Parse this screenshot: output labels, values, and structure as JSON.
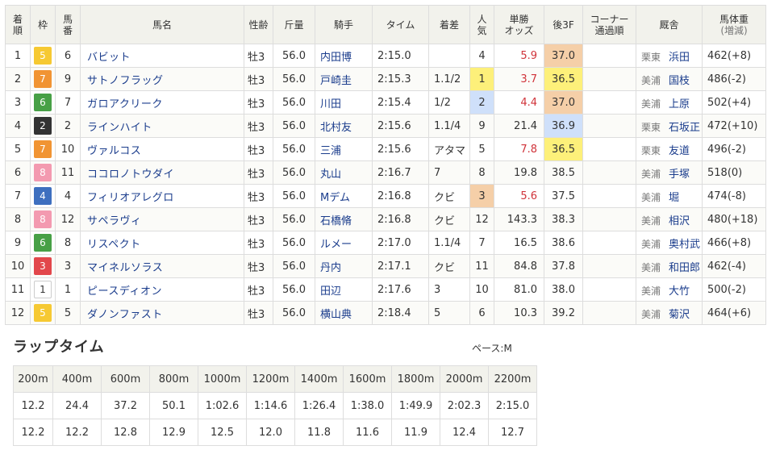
{
  "headers": {
    "rank": "着順",
    "waku": "枠",
    "num": "馬番",
    "name": "馬名",
    "sexage": "性齢",
    "weight": "斤量",
    "jockey": "騎手",
    "time": "タイム",
    "margin": "着差",
    "pop": "人気",
    "odds": "単勝オッズ",
    "f3": "後3F",
    "corner": "コーナー通過順",
    "trainer": "厩舎",
    "body": "馬体重(増減)"
  },
  "rows": [
    {
      "rank": "1",
      "waku": "5",
      "num": "6",
      "name": "バビット",
      "sexage": "牡3",
      "weight": "56.0",
      "jockey": "内田博",
      "time": "2:15.0",
      "margin": "",
      "pop": "4",
      "odds": "5.9",
      "f3": "37.0",
      "corner": "",
      "region": "栗東",
      "trainer": "浜田",
      "body": "462(+8)"
    },
    {
      "rank": "2",
      "waku": "7",
      "num": "9",
      "name": "サトノフラッグ",
      "sexage": "牡3",
      "weight": "56.0",
      "jockey": "戸崎圭",
      "time": "2:15.3",
      "margin": "1.1/2",
      "pop": "1",
      "odds": "3.7",
      "f3": "36.5",
      "corner": "",
      "region": "美浦",
      "trainer": "国枝",
      "body": "486(-2)"
    },
    {
      "rank": "3",
      "waku": "6",
      "num": "7",
      "name": "ガロアクリーク",
      "sexage": "牡3",
      "weight": "56.0",
      "jockey": "川田",
      "time": "2:15.4",
      "margin": "1/2",
      "pop": "2",
      "odds": "4.4",
      "f3": "37.0",
      "corner": "",
      "region": "美浦",
      "trainer": "上原",
      "body": "502(+4)"
    },
    {
      "rank": "4",
      "waku": "2",
      "num": "2",
      "name": "ラインハイト",
      "sexage": "牡3",
      "weight": "56.0",
      "jockey": "北村友",
      "time": "2:15.6",
      "margin": "1.1/4",
      "pop": "9",
      "odds": "21.4",
      "f3": "36.9",
      "corner": "",
      "region": "栗東",
      "trainer": "石坂正",
      "body": "472(+10)"
    },
    {
      "rank": "5",
      "waku": "7",
      "num": "10",
      "name": "ヴァルコス",
      "sexage": "牡3",
      "weight": "56.0",
      "jockey": "三浦",
      "time": "2:15.6",
      "margin": "アタマ",
      "pop": "5",
      "odds": "7.8",
      "f3": "36.5",
      "corner": "",
      "region": "栗東",
      "trainer": "友道",
      "body": "496(-2)"
    },
    {
      "rank": "6",
      "waku": "8",
      "num": "11",
      "name": "ココロノトウダイ",
      "sexage": "牡3",
      "weight": "56.0",
      "jockey": "丸山",
      "time": "2:16.7",
      "margin": "7",
      "pop": "8",
      "odds": "19.8",
      "f3": "38.5",
      "corner": "",
      "region": "美浦",
      "trainer": "手塚",
      "body": "518(0)"
    },
    {
      "rank": "7",
      "waku": "4",
      "num": "4",
      "name": "フィリオアレグロ",
      "sexage": "牡3",
      "weight": "56.0",
      "jockey": "Mデム",
      "time": "2:16.8",
      "margin": "クビ",
      "pop": "3",
      "odds": "5.6",
      "f3": "37.5",
      "corner": "",
      "region": "美浦",
      "trainer": "堀",
      "body": "474(-8)"
    },
    {
      "rank": "8",
      "waku": "8",
      "num": "12",
      "name": "サペラヴィ",
      "sexage": "牡3",
      "weight": "56.0",
      "jockey": "石橋脩",
      "time": "2:16.8",
      "margin": "クビ",
      "pop": "12",
      "odds": "143.3",
      "f3": "38.3",
      "corner": "",
      "region": "美浦",
      "trainer": "相沢",
      "body": "480(+18)"
    },
    {
      "rank": "9",
      "waku": "6",
      "num": "8",
      "name": "リスペクト",
      "sexage": "牡3",
      "weight": "56.0",
      "jockey": "ルメー",
      "time": "2:17.0",
      "margin": "1.1/4",
      "pop": "7",
      "odds": "16.5",
      "f3": "38.6",
      "corner": "",
      "region": "美浦",
      "trainer": "奥村武",
      "body": "466(+8)"
    },
    {
      "rank": "10",
      "waku": "3",
      "num": "3",
      "name": "マイネルソラス",
      "sexage": "牡3",
      "weight": "56.0",
      "jockey": "丹内",
      "time": "2:17.1",
      "margin": "クビ",
      "pop": "11",
      "odds": "84.8",
      "f3": "37.8",
      "corner": "",
      "region": "美浦",
      "trainer": "和田郎",
      "body": "462(-4)"
    },
    {
      "rank": "11",
      "waku": "1",
      "num": "1",
      "name": "ピースディオン",
      "sexage": "牡3",
      "weight": "56.0",
      "jockey": "田辺",
      "time": "2:17.6",
      "margin": "3",
      "pop": "10",
      "odds": "81.0",
      "f3": "38.0",
      "corner": "",
      "region": "美浦",
      "trainer": "大竹",
      "body": "500(-2)"
    },
    {
      "rank": "12",
      "waku": "5",
      "num": "5",
      "name": "ダノンファスト",
      "sexage": "牡3",
      "weight": "56.0",
      "jockey": "横山典",
      "time": "2:18.4",
      "margin": "5",
      "pop": "6",
      "odds": "10.3",
      "f3": "39.2",
      "corner": "",
      "region": "美浦",
      "trainer": "菊沢",
      "body": "464(+6)"
    }
  ],
  "lap": {
    "title": "ラップタイム",
    "pace": "ペース:M",
    "distances": [
      "200m",
      "400m",
      "600m",
      "800m",
      "1000m",
      "1200m",
      "1400m",
      "1600m",
      "1800m",
      "2000m",
      "2200m"
    ],
    "cumulative": [
      "12.2",
      "24.4",
      "37.2",
      "50.1",
      "1:02.6",
      "1:14.6",
      "1:26.4",
      "1:38.0",
      "1:49.9",
      "2:02.3",
      "2:15.0"
    ],
    "splits": [
      "12.2",
      "12.2",
      "12.8",
      "12.9",
      "12.5",
      "12.0",
      "11.8",
      "11.6",
      "11.9",
      "12.4",
      "12.7"
    ]
  }
}
